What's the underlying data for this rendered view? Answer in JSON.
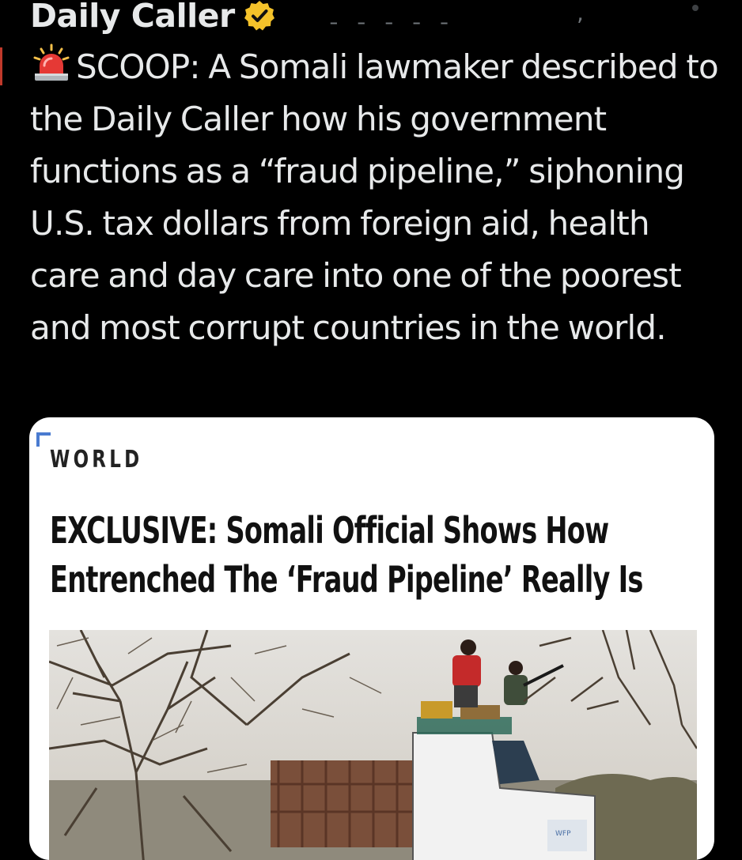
{
  "tweet": {
    "author_name": "Daily Caller",
    "text": "SCOOP: A Somali lawmaker described to the Daily Caller how his government functions as a “fraud pipeline,” siphoning U.S. tax dollars from foreign aid, health care and day care into one of the poorest and most corrupt countries in the world.",
    "text_prefix_icon": "police-siren-emoji"
  },
  "card": {
    "section": "WORLD",
    "headline": "EXCLUSIVE: Somali Official Shows How Entrenched The ‘Fraud Pipeline’ Really Is",
    "image_description_icon": "news-photo",
    "truck_logo": "WFP"
  },
  "colors": {
    "background": "#000000",
    "text": "#e7e9ea",
    "verified_badge": "#f4c22a",
    "card_background": "#ffffff",
    "headline": "#111111",
    "accent": "#4a7bd0"
  }
}
